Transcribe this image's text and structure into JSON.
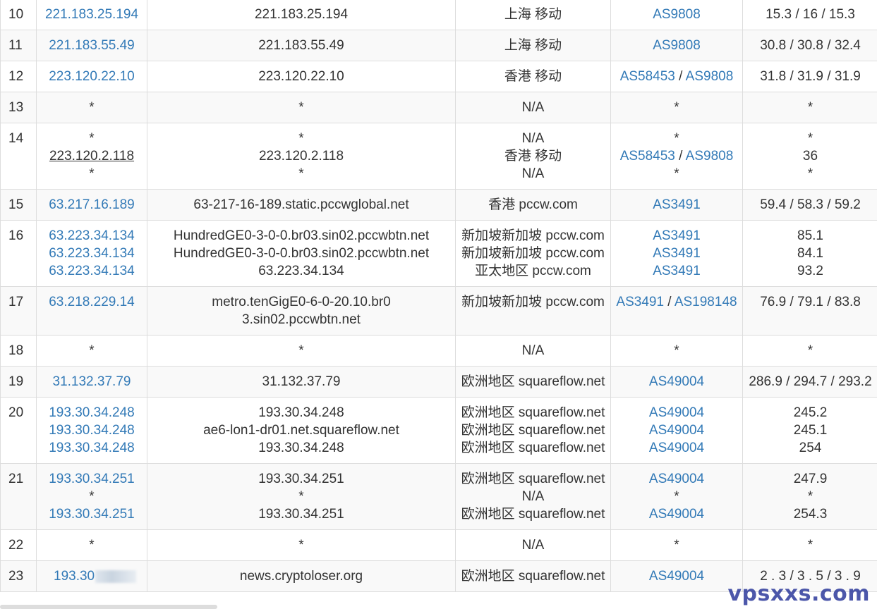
{
  "rows": [
    {
      "hop": "10",
      "ips": [
        "221.183.25.194"
      ],
      "hosts": [
        "221.183.25.194"
      ],
      "locs": [
        "上海 移动"
      ],
      "asns": [
        [
          "AS9808"
        ]
      ],
      "times": [
        "15.3 / 16 / 15.3"
      ]
    },
    {
      "hop": "11",
      "ips": [
        "221.183.55.49"
      ],
      "hosts": [
        "221.183.55.49"
      ],
      "locs": [
        "上海 移动"
      ],
      "asns": [
        [
          "AS9808"
        ]
      ],
      "times": [
        "30.8 / 30.8 / 32.4"
      ]
    },
    {
      "hop": "12",
      "ips": [
        "223.120.22.10"
      ],
      "hosts": [
        "223.120.22.10"
      ],
      "locs": [
        "香港 移动"
      ],
      "asns": [
        [
          "AS58453",
          "AS9808"
        ]
      ],
      "times": [
        "31.8 / 31.9 / 31.9"
      ]
    },
    {
      "hop": "13",
      "ips": [
        "*"
      ],
      "hosts": [
        "*"
      ],
      "locs": [
        "N/A"
      ],
      "asns": [
        [
          "*"
        ]
      ],
      "times": [
        "*"
      ]
    },
    {
      "hop": "14",
      "ips": [
        "*",
        "223.120.2.118",
        "*"
      ],
      "hosts": [
        "*",
        "223.120.2.118",
        "*"
      ],
      "locs": [
        "N/A",
        "香港 移动",
        "N/A"
      ],
      "asns": [
        [
          "*"
        ],
        [
          "AS58453",
          "AS9808"
        ],
        [
          "*"
        ]
      ],
      "times": [
        "*",
        "36",
        "*"
      ]
    },
    {
      "hop": "15",
      "ips": [
        "63.217.16.189"
      ],
      "hosts": [
        "63-217-16-189.static.pccwglobal.net"
      ],
      "locs": [
        "香港 pccw.com"
      ],
      "asns": [
        [
          "AS3491"
        ]
      ],
      "times": [
        "59.4 / 58.3 / 59.2"
      ]
    },
    {
      "hop": "16",
      "ips": [
        "63.223.34.134",
        "63.223.34.134",
        "63.223.34.134"
      ],
      "hosts": [
        "HundredGE0-3-0-0.br03.sin02.pccwbtn.net",
        "HundredGE0-3-0-0.br03.sin02.pccwbtn.net",
        "63.223.34.134"
      ],
      "locs": [
        "新加坡新加坡 pccw.com",
        "新加坡新加坡 pccw.com",
        "亚太地区 pccw.com"
      ],
      "asns": [
        [
          "AS3491"
        ],
        [
          "AS3491"
        ],
        [
          "AS3491"
        ]
      ],
      "times": [
        "85.1",
        "84.1",
        "93.2"
      ]
    },
    {
      "hop": "17",
      "ips": [
        "63.218.229.14"
      ],
      "hosts": [
        "metro.tenGigE0-6-0-20.10.br03.sin02.pccwbtn.net"
      ],
      "locs": [
        "新加坡新加坡 pccw.com"
      ],
      "asns": [
        [
          "AS3491",
          "AS198148"
        ]
      ],
      "times": [
        "76.9 / 79.1 / 83.8"
      ]
    },
    {
      "hop": "18",
      "ips": [
        "*"
      ],
      "hosts": [
        "*"
      ],
      "locs": [
        "N/A"
      ],
      "asns": [
        [
          "*"
        ]
      ],
      "times": [
        "*"
      ]
    },
    {
      "hop": "19",
      "ips": [
        "31.132.37.79"
      ],
      "hosts": [
        "31.132.37.79"
      ],
      "locs": [
        "欧洲地区 squareflow.net"
      ],
      "asns": [
        [
          "AS49004"
        ]
      ],
      "times": [
        "286.9 / 294.7 / 293.2"
      ]
    },
    {
      "hop": "20",
      "ips": [
        "193.30.34.248",
        "193.30.34.248",
        "193.30.34.248"
      ],
      "hosts": [
        "193.30.34.248",
        "ae6-lon1-dr01.net.squareflow.net",
        "193.30.34.248"
      ],
      "locs": [
        "欧洲地区 squareflow.net",
        "欧洲地区 squareflow.net",
        "欧洲地区 squareflow.net"
      ],
      "asns": [
        [
          "AS49004"
        ],
        [
          "AS49004"
        ],
        [
          "AS49004"
        ]
      ],
      "times": [
        "245.2",
        "245.1",
        "254"
      ]
    },
    {
      "hop": "21",
      "ips": [
        "193.30.34.251",
        "*",
        "193.30.34.251"
      ],
      "hosts": [
        "193.30.34.251",
        "*",
        "193.30.34.251"
      ],
      "locs": [
        "欧洲地区 squareflow.net",
        "N/A",
        "欧洲地区 squareflow.net"
      ],
      "asns": [
        [
          "AS49004"
        ],
        [
          "*"
        ],
        [
          "AS49004"
        ]
      ],
      "times": [
        "247.9",
        "*",
        "254.3"
      ]
    },
    {
      "hop": "22",
      "ips": [
        "*"
      ],
      "hosts": [
        "*"
      ],
      "locs": [
        "N/A"
      ],
      "asns": [
        [
          "*"
        ]
      ],
      "times": [
        "*"
      ]
    },
    {
      "hop": "23",
      "ips": [
        "193.30"
      ],
      "hosts": [
        "news.cryptoloser.org"
      ],
      "locs": [
        "欧洲地区 squareflow.net"
      ],
      "asns": [
        [
          "AS49004"
        ]
      ],
      "times": [
        "2 . 3 / 3 . 5 / 3 . 9"
      ]
    }
  ],
  "watermark": "vpsxxs.com"
}
